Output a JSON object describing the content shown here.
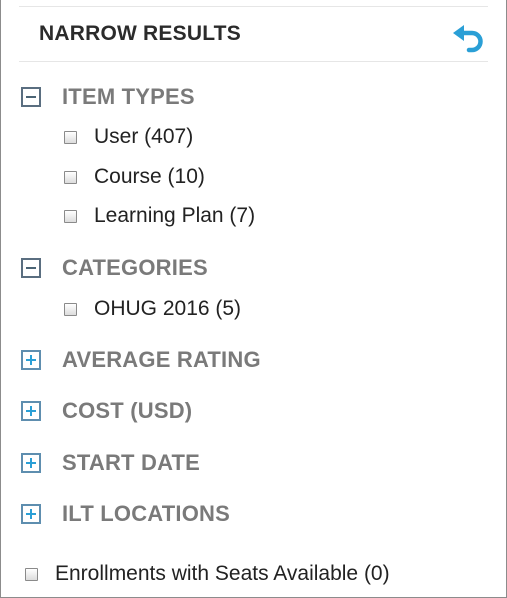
{
  "header": {
    "title": "NARROW RESULTS",
    "reset_icon": "undo-arrow-icon"
  },
  "sections": [
    {
      "title": "ITEM TYPES",
      "state": "expanded",
      "options": [
        {
          "label": "User (407)",
          "checked": false
        },
        {
          "label": "Course (10)",
          "checked": false
        },
        {
          "label": "Learning Plan (7)",
          "checked": false
        }
      ]
    },
    {
      "title": "CATEGORIES",
      "state": "expanded",
      "options": [
        {
          "label": "OHUG 2016 (5)",
          "checked": false
        }
      ]
    },
    {
      "title": "AVERAGE RATING",
      "state": "collapsed"
    },
    {
      "title": "COST (USD)",
      "state": "collapsed"
    },
    {
      "title": "START DATE",
      "state": "collapsed"
    },
    {
      "title": "ILT LOCATIONS",
      "state": "collapsed"
    }
  ],
  "footer_option": {
    "label": "Enrollments with Seats Available (0)",
    "checked": false
  },
  "colors": {
    "accent_blue": "#2a9fd6",
    "heading_gray": "#7a7a7a",
    "title_dark": "#2b2b2b"
  }
}
